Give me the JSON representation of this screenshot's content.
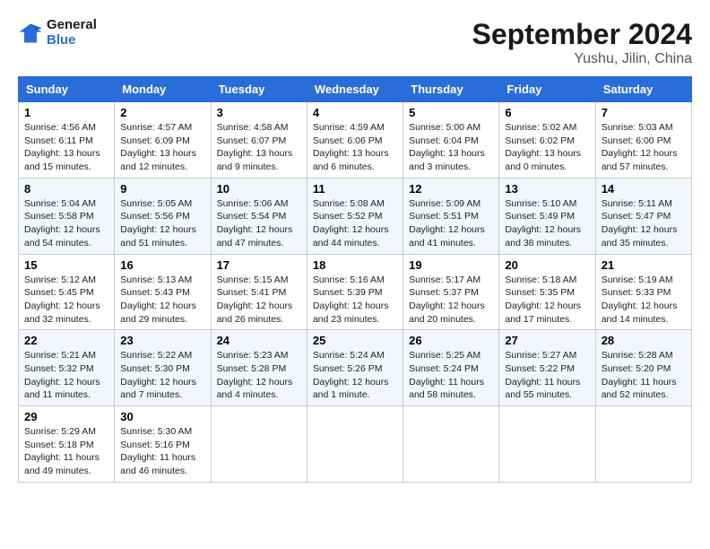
{
  "header": {
    "logo_line1": "General",
    "logo_line2": "Blue",
    "month": "September 2024",
    "location": "Yushu, Jilin, China"
  },
  "weekdays": [
    "Sunday",
    "Monday",
    "Tuesday",
    "Wednesday",
    "Thursday",
    "Friday",
    "Saturday"
  ],
  "weeks": [
    [
      {
        "day": "1",
        "info": "Sunrise: 4:56 AM\nSunset: 6:11 PM\nDaylight: 13 hours\nand 15 minutes."
      },
      {
        "day": "2",
        "info": "Sunrise: 4:57 AM\nSunset: 6:09 PM\nDaylight: 13 hours\nand 12 minutes."
      },
      {
        "day": "3",
        "info": "Sunrise: 4:58 AM\nSunset: 6:07 PM\nDaylight: 13 hours\nand 9 minutes."
      },
      {
        "day": "4",
        "info": "Sunrise: 4:59 AM\nSunset: 6:06 PM\nDaylight: 13 hours\nand 6 minutes."
      },
      {
        "day": "5",
        "info": "Sunrise: 5:00 AM\nSunset: 6:04 PM\nDaylight: 13 hours\nand 3 minutes."
      },
      {
        "day": "6",
        "info": "Sunrise: 5:02 AM\nSunset: 6:02 PM\nDaylight: 13 hours\nand 0 minutes."
      },
      {
        "day": "7",
        "info": "Sunrise: 5:03 AM\nSunset: 6:00 PM\nDaylight: 12 hours\nand 57 minutes."
      }
    ],
    [
      {
        "day": "8",
        "info": "Sunrise: 5:04 AM\nSunset: 5:58 PM\nDaylight: 12 hours\nand 54 minutes."
      },
      {
        "day": "9",
        "info": "Sunrise: 5:05 AM\nSunset: 5:56 PM\nDaylight: 12 hours\nand 51 minutes."
      },
      {
        "day": "10",
        "info": "Sunrise: 5:06 AM\nSunset: 5:54 PM\nDaylight: 12 hours\nand 47 minutes."
      },
      {
        "day": "11",
        "info": "Sunrise: 5:08 AM\nSunset: 5:52 PM\nDaylight: 12 hours\nand 44 minutes."
      },
      {
        "day": "12",
        "info": "Sunrise: 5:09 AM\nSunset: 5:51 PM\nDaylight: 12 hours\nand 41 minutes."
      },
      {
        "day": "13",
        "info": "Sunrise: 5:10 AM\nSunset: 5:49 PM\nDaylight: 12 hours\nand 38 minutes."
      },
      {
        "day": "14",
        "info": "Sunrise: 5:11 AM\nSunset: 5:47 PM\nDaylight: 12 hours\nand 35 minutes."
      }
    ],
    [
      {
        "day": "15",
        "info": "Sunrise: 5:12 AM\nSunset: 5:45 PM\nDaylight: 12 hours\nand 32 minutes."
      },
      {
        "day": "16",
        "info": "Sunrise: 5:13 AM\nSunset: 5:43 PM\nDaylight: 12 hours\nand 29 minutes."
      },
      {
        "day": "17",
        "info": "Sunrise: 5:15 AM\nSunset: 5:41 PM\nDaylight: 12 hours\nand 26 minutes."
      },
      {
        "day": "18",
        "info": "Sunrise: 5:16 AM\nSunset: 5:39 PM\nDaylight: 12 hours\nand 23 minutes."
      },
      {
        "day": "19",
        "info": "Sunrise: 5:17 AM\nSunset: 5:37 PM\nDaylight: 12 hours\nand 20 minutes."
      },
      {
        "day": "20",
        "info": "Sunrise: 5:18 AM\nSunset: 5:35 PM\nDaylight: 12 hours\nand 17 minutes."
      },
      {
        "day": "21",
        "info": "Sunrise: 5:19 AM\nSunset: 5:33 PM\nDaylight: 12 hours\nand 14 minutes."
      }
    ],
    [
      {
        "day": "22",
        "info": "Sunrise: 5:21 AM\nSunset: 5:32 PM\nDaylight: 12 hours\nand 11 minutes."
      },
      {
        "day": "23",
        "info": "Sunrise: 5:22 AM\nSunset: 5:30 PM\nDaylight: 12 hours\nand 7 minutes."
      },
      {
        "day": "24",
        "info": "Sunrise: 5:23 AM\nSunset: 5:28 PM\nDaylight: 12 hours\nand 4 minutes."
      },
      {
        "day": "25",
        "info": "Sunrise: 5:24 AM\nSunset: 5:26 PM\nDaylight: 12 hours\nand 1 minute."
      },
      {
        "day": "26",
        "info": "Sunrise: 5:25 AM\nSunset: 5:24 PM\nDaylight: 11 hours\nand 58 minutes."
      },
      {
        "day": "27",
        "info": "Sunrise: 5:27 AM\nSunset: 5:22 PM\nDaylight: 11 hours\nand 55 minutes."
      },
      {
        "day": "28",
        "info": "Sunrise: 5:28 AM\nSunset: 5:20 PM\nDaylight: 11 hours\nand 52 minutes."
      }
    ],
    [
      {
        "day": "29",
        "info": "Sunrise: 5:29 AM\nSunset: 5:18 PM\nDaylight: 11 hours\nand 49 minutes."
      },
      {
        "day": "30",
        "info": "Sunrise: 5:30 AM\nSunset: 5:16 PM\nDaylight: 11 hours\nand 46 minutes."
      },
      {
        "day": "",
        "info": ""
      },
      {
        "day": "",
        "info": ""
      },
      {
        "day": "",
        "info": ""
      },
      {
        "day": "",
        "info": ""
      },
      {
        "day": "",
        "info": ""
      }
    ]
  ]
}
